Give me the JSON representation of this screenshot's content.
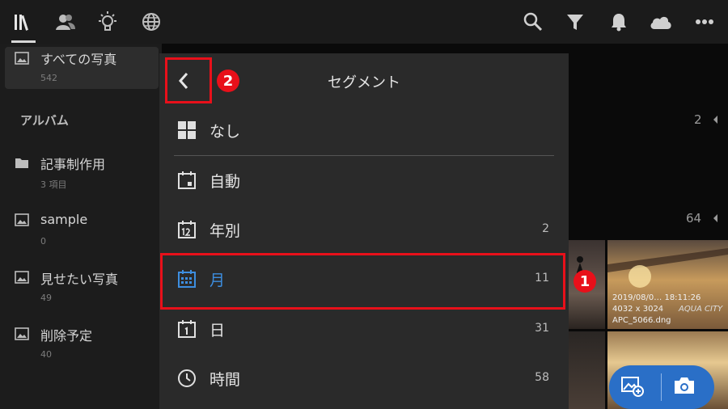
{
  "topbar": {
    "left_icons": [
      "library-icon",
      "people-icon",
      "learn-icon",
      "discover-icon"
    ],
    "right_icons": [
      "search-icon",
      "filter-icon",
      "bell-icon",
      "cloud-icon",
      "more-icon"
    ]
  },
  "sidebar": {
    "all_photos": {
      "label": "すべての写真",
      "count": "542"
    },
    "albums_heading": "アルバム",
    "albums": [
      {
        "label": "記事制作用",
        "count": "3 項目",
        "icon": "folder-icon"
      },
      {
        "label": "sample",
        "count": "0",
        "icon": "album-icon"
      },
      {
        "label": "見せたい写真",
        "count": "49",
        "icon": "album-icon"
      },
      {
        "label": "削除予定",
        "count": "40",
        "icon": "album-icon"
      }
    ]
  },
  "content": {
    "group_counts": [
      "2",
      "64"
    ],
    "photo_info": {
      "date": "2019/08/0… 18:11:26",
      "size": "4032 x 3024",
      "filename": "APC_5066.dng",
      "sign": "AQUA CITY"
    }
  },
  "panel": {
    "title": "セグメント",
    "options": [
      {
        "label": "なし",
        "count": "",
        "icon": "grid-icon"
      },
      {
        "label": "自動",
        "count": "",
        "icon": "calendar-auto-icon"
      },
      {
        "label": "年別",
        "count": "2",
        "icon": "calendar-year-icon"
      },
      {
        "label": "月",
        "count": "11",
        "icon": "calendar-month-icon",
        "selected": true
      },
      {
        "label": "日",
        "count": "31",
        "icon": "calendar-day-icon"
      },
      {
        "label": "時間",
        "count": "58",
        "icon": "clock-icon"
      }
    ]
  },
  "annotations": {
    "badge1": "1",
    "badge2": "2"
  },
  "colors": {
    "accent": "#3d8ee0",
    "highlight": "#e8101a",
    "fab": "#2a6fc7"
  }
}
